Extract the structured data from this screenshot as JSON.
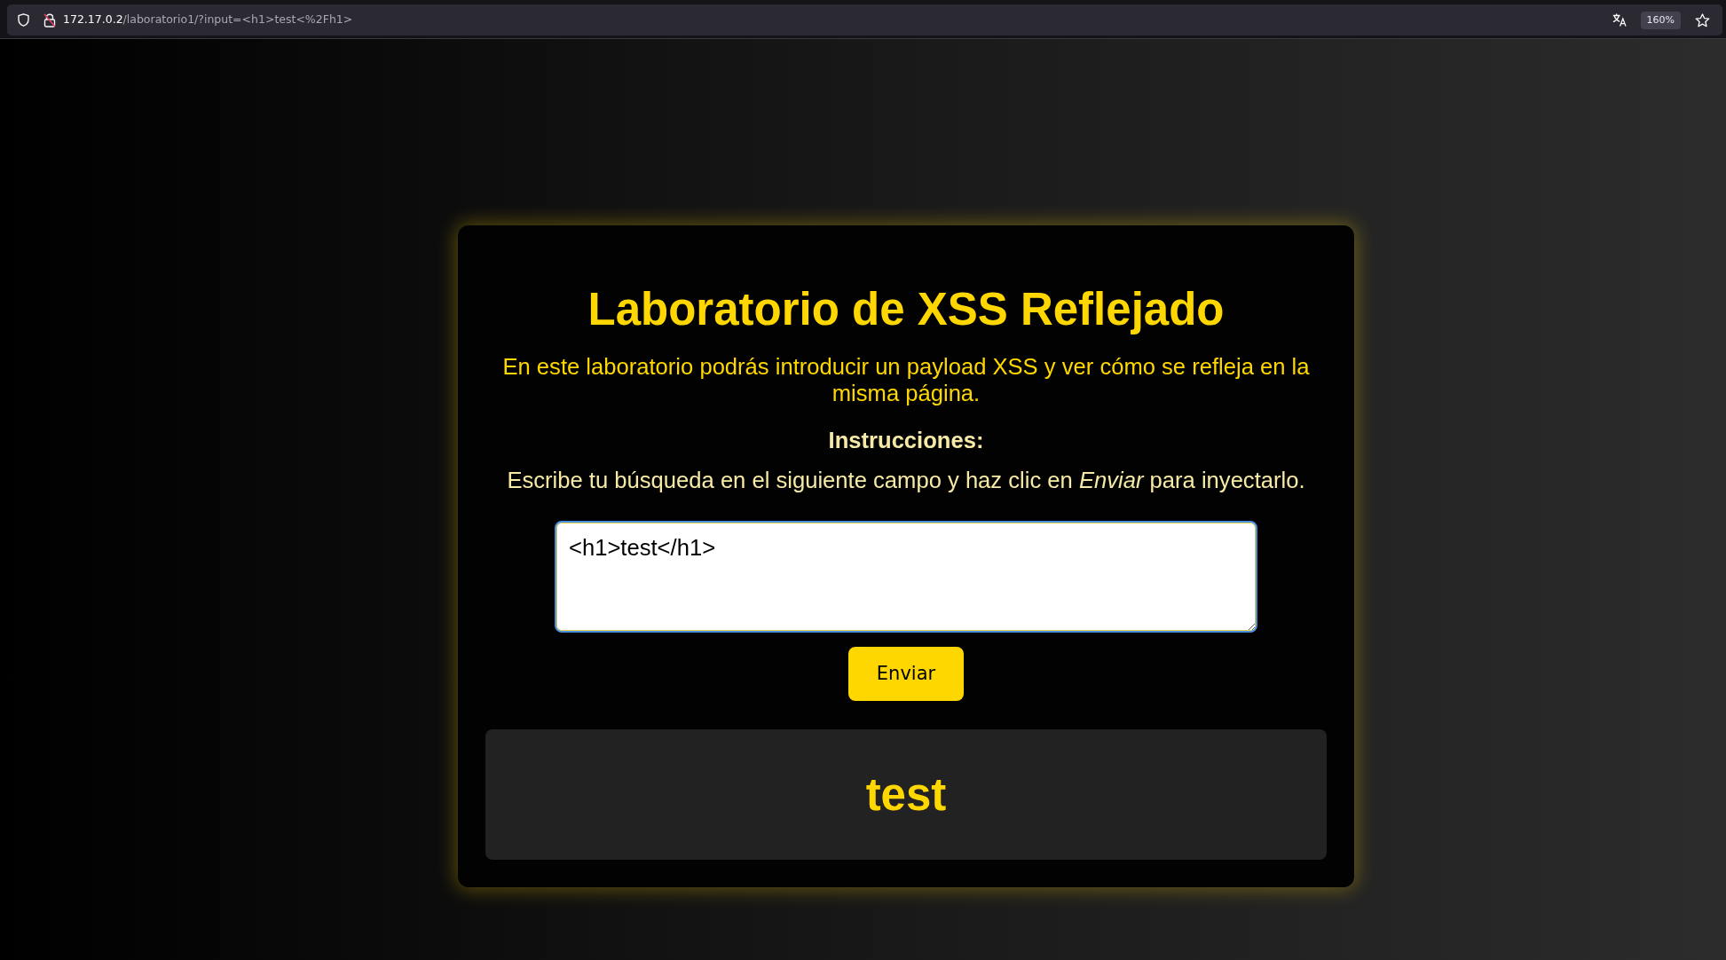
{
  "browser": {
    "url": {
      "host": "172.17.0.2",
      "path": "/laboratorio1/?input=<h1>test<%2Fh1>"
    },
    "zoom": "160%"
  },
  "lab": {
    "title": "Laboratorio de XSS Reflejado",
    "intro": "En este laboratorio podrás introducir un payload XSS y ver cómo se refleja en la misma página.",
    "instructions_heading": "Instrucciones:",
    "instructions": "Escribe tu búsqueda en el siguiente campo y haz clic en *Enviar* para inyectarlo.",
    "payload_field": {
      "value": "<h1>test</h1>",
      "focused": true
    },
    "submit_button": "Enviar",
    "result": "test"
  }
}
